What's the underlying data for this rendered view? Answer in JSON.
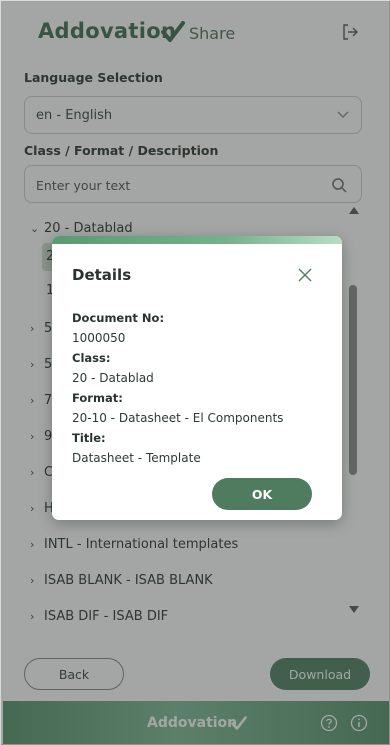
{
  "header": {
    "brand": "Addovation",
    "brand_sub": "Share"
  },
  "language": {
    "label": "Language Selection",
    "selected": "en - English"
  },
  "classification": {
    "label": "Class / Format / Description",
    "placeholder": "Enter your text"
  },
  "tree": {
    "expanded": "20 - Datablad",
    "children": [
      "2",
      "1"
    ],
    "collapsed": [
      "5",
      "5",
      "7",
      "9",
      "C",
      "H",
      "INTL - International templates",
      "ISAB BLANK - ISAB BLANK",
      "ISAB DIF - ISAB DIF"
    ]
  },
  "buttons": {
    "back": "Back",
    "download": "Download"
  },
  "footer": {
    "brand": "Addovation"
  },
  "dialog": {
    "title": "Details",
    "fields": [
      {
        "label": "Document No:",
        "value": "1000050"
      },
      {
        "label": "Class:",
        "value": "20 - Datablad"
      },
      {
        "label": "Format:",
        "value": "20-10 - Datasheet - El Components"
      },
      {
        "label": "Title:",
        "value": "Datasheet - Template"
      }
    ],
    "ok_label": "OK"
  },
  "colors": {
    "brand_green": "#3d6b4e",
    "button_green": "#4f7c5f",
    "footer_gradient": [
      "#55906a",
      "#7fb996"
    ]
  },
  "icons": {
    "header": "logout-icon",
    "language": "chevron-down-icon",
    "search": "search-icon",
    "dialog": "close-icon",
    "footer": [
      "help-icon",
      "info-icon"
    ]
  }
}
